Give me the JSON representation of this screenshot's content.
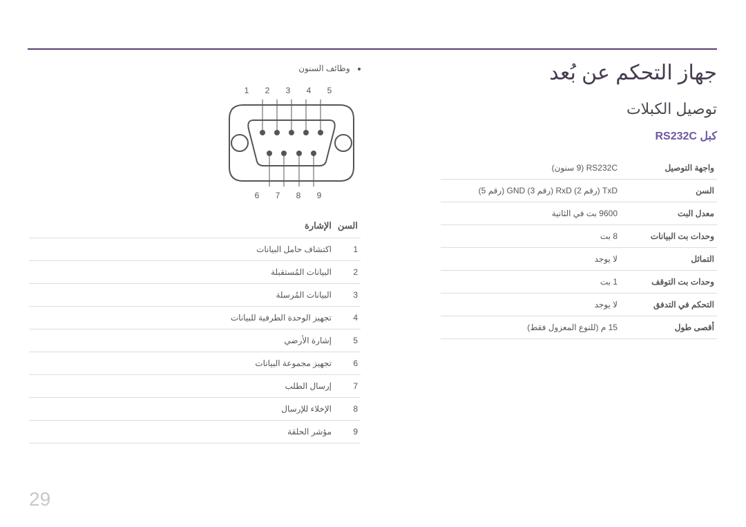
{
  "page_number": "29",
  "title": "جهاز التحكم عن بُعد",
  "subtitle": "توصيل الكبلات",
  "cable_label": "كبل RS232C",
  "specs": [
    {
      "label": "واجهة التوصيل",
      "value": "RS232C (9 سنون)"
    },
    {
      "label": "السن",
      "value": "TxD (رقم 2) RxD (رقم 3) GND (رقم 5)"
    },
    {
      "label": "معدل البت",
      "value": "9600 بت في الثانية"
    },
    {
      "label": "وحدات بت البيانات",
      "value": "8 بت"
    },
    {
      "label": "التماثل",
      "value": "لا يوجد"
    },
    {
      "label": "وحدات بت التوقف",
      "value": "1 بت"
    },
    {
      "label": "التحكم في التدفق",
      "value": "لا يوجد"
    },
    {
      "label": "أقصى طول",
      "value": "15 م (للنوع المعزول فقط)"
    }
  ],
  "bullet_label": "وظائف السنون",
  "pin_top": "1 2 3 4 5",
  "pin_bot": "6 7 8 9",
  "pin_header_num": "السن",
  "pin_header_sig": "الإشارة",
  "pins": [
    {
      "n": "1",
      "sig": "اكتشاف حامل البيانات"
    },
    {
      "n": "2",
      "sig": "البيانات المُستقبلة"
    },
    {
      "n": "3",
      "sig": "البيانات المُرسلة"
    },
    {
      "n": "4",
      "sig": "تجهيز الوحدة الطرفية للبيانات"
    },
    {
      "n": "5",
      "sig": "إشارة الأرضي"
    },
    {
      "n": "6",
      "sig": "تجهيز مجموعة البيانات"
    },
    {
      "n": "7",
      "sig": "إرسال الطلب"
    },
    {
      "n": "8",
      "sig": "الإخلاء للإرسال"
    },
    {
      "n": "9",
      "sig": "مؤشر الحلقة"
    }
  ]
}
